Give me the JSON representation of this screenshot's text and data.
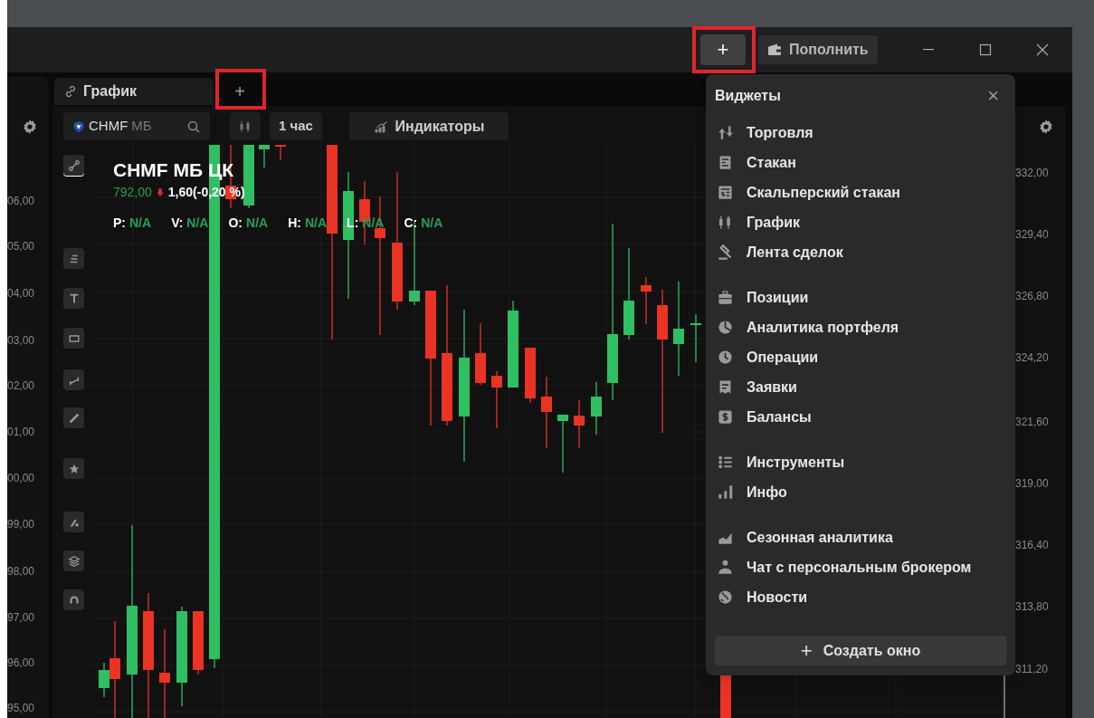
{
  "title_bar": {
    "add_button": "+",
    "top_up_button": "Пополнить"
  },
  "chart_tab": {
    "label": "График",
    "add_tab_button": "+"
  },
  "toolbar": {
    "ticker": "CHMF",
    "exchange": "МБ",
    "interval": "1 час",
    "indicators": "Индикаторы"
  },
  "instrument": {
    "name": "CHMF МБ ЦК",
    "price": "792,00",
    "change": "1,60(-0,20 %)"
  },
  "ohlc": [
    {
      "label": "P:",
      "value": "N/A"
    },
    {
      "label": "V:",
      "value": "N/A"
    },
    {
      "label": "O:",
      "value": "N/A"
    },
    {
      "label": "H:",
      "value": "N/A"
    },
    {
      "label": "L:",
      "value": "N/A"
    },
    {
      "label": "C:",
      "value": "N/A"
    }
  ],
  "left_axis": [
    "06,00",
    "05,00",
    "04,00",
    "03,00",
    "02,00",
    "01,00",
    "00,00",
    "99,00",
    "98,00",
    "97,00",
    "96,00",
    "95,00"
  ],
  "right_axis": [
    "332,00",
    "329,40",
    "326,80",
    "324,20",
    "321,60",
    "319,00",
    "316,40",
    "313,80",
    "311,20"
  ],
  "widgets_menu": {
    "title": "Виджеты",
    "close": "×",
    "groups": [
      [
        {
          "label": "Торговля"
        },
        {
          "label": "Стакан"
        },
        {
          "label": "Скальперский стакан"
        },
        {
          "label": "График"
        },
        {
          "label": "Лента сделок"
        }
      ],
      [
        {
          "label": "Позиции"
        },
        {
          "label": "Аналитика портфеля"
        },
        {
          "label": "Операции"
        },
        {
          "label": "Заявки"
        },
        {
          "label": "Балансы"
        }
      ],
      [
        {
          "label": "Инструменты"
        },
        {
          "label": "Инфо"
        }
      ],
      [
        {
          "label": "Сезонная аналитика"
        },
        {
          "label": "Чат с персональным брокером"
        },
        {
          "label": "Новости"
        }
      ]
    ],
    "create_button": {
      "icon": "+",
      "label": "Создать окно"
    }
  }
}
